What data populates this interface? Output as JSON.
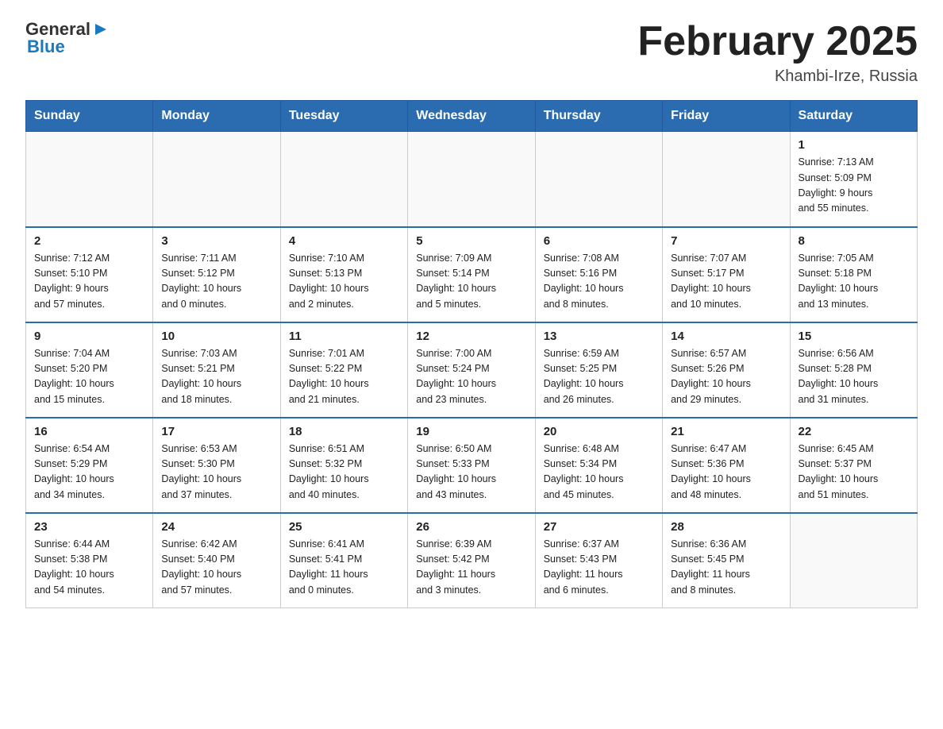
{
  "header": {
    "logo_general": "General",
    "logo_blue": "Blue",
    "month_title": "February 2025",
    "location": "Khambi-Irze, Russia"
  },
  "days_of_week": [
    "Sunday",
    "Monday",
    "Tuesday",
    "Wednesday",
    "Thursday",
    "Friday",
    "Saturday"
  ],
  "weeks": [
    [
      {
        "day": "",
        "info": ""
      },
      {
        "day": "",
        "info": ""
      },
      {
        "day": "",
        "info": ""
      },
      {
        "day": "",
        "info": ""
      },
      {
        "day": "",
        "info": ""
      },
      {
        "day": "",
        "info": ""
      },
      {
        "day": "1",
        "info": "Sunrise: 7:13 AM\nSunset: 5:09 PM\nDaylight: 9 hours\nand 55 minutes."
      }
    ],
    [
      {
        "day": "2",
        "info": "Sunrise: 7:12 AM\nSunset: 5:10 PM\nDaylight: 9 hours\nand 57 minutes."
      },
      {
        "day": "3",
        "info": "Sunrise: 7:11 AM\nSunset: 5:12 PM\nDaylight: 10 hours\nand 0 minutes."
      },
      {
        "day": "4",
        "info": "Sunrise: 7:10 AM\nSunset: 5:13 PM\nDaylight: 10 hours\nand 2 minutes."
      },
      {
        "day": "5",
        "info": "Sunrise: 7:09 AM\nSunset: 5:14 PM\nDaylight: 10 hours\nand 5 minutes."
      },
      {
        "day": "6",
        "info": "Sunrise: 7:08 AM\nSunset: 5:16 PM\nDaylight: 10 hours\nand 8 minutes."
      },
      {
        "day": "7",
        "info": "Sunrise: 7:07 AM\nSunset: 5:17 PM\nDaylight: 10 hours\nand 10 minutes."
      },
      {
        "day": "8",
        "info": "Sunrise: 7:05 AM\nSunset: 5:18 PM\nDaylight: 10 hours\nand 13 minutes."
      }
    ],
    [
      {
        "day": "9",
        "info": "Sunrise: 7:04 AM\nSunset: 5:20 PM\nDaylight: 10 hours\nand 15 minutes."
      },
      {
        "day": "10",
        "info": "Sunrise: 7:03 AM\nSunset: 5:21 PM\nDaylight: 10 hours\nand 18 minutes."
      },
      {
        "day": "11",
        "info": "Sunrise: 7:01 AM\nSunset: 5:22 PM\nDaylight: 10 hours\nand 21 minutes."
      },
      {
        "day": "12",
        "info": "Sunrise: 7:00 AM\nSunset: 5:24 PM\nDaylight: 10 hours\nand 23 minutes."
      },
      {
        "day": "13",
        "info": "Sunrise: 6:59 AM\nSunset: 5:25 PM\nDaylight: 10 hours\nand 26 minutes."
      },
      {
        "day": "14",
        "info": "Sunrise: 6:57 AM\nSunset: 5:26 PM\nDaylight: 10 hours\nand 29 minutes."
      },
      {
        "day": "15",
        "info": "Sunrise: 6:56 AM\nSunset: 5:28 PM\nDaylight: 10 hours\nand 31 minutes."
      }
    ],
    [
      {
        "day": "16",
        "info": "Sunrise: 6:54 AM\nSunset: 5:29 PM\nDaylight: 10 hours\nand 34 minutes."
      },
      {
        "day": "17",
        "info": "Sunrise: 6:53 AM\nSunset: 5:30 PM\nDaylight: 10 hours\nand 37 minutes."
      },
      {
        "day": "18",
        "info": "Sunrise: 6:51 AM\nSunset: 5:32 PM\nDaylight: 10 hours\nand 40 minutes."
      },
      {
        "day": "19",
        "info": "Sunrise: 6:50 AM\nSunset: 5:33 PM\nDaylight: 10 hours\nand 43 minutes."
      },
      {
        "day": "20",
        "info": "Sunrise: 6:48 AM\nSunset: 5:34 PM\nDaylight: 10 hours\nand 45 minutes."
      },
      {
        "day": "21",
        "info": "Sunrise: 6:47 AM\nSunset: 5:36 PM\nDaylight: 10 hours\nand 48 minutes."
      },
      {
        "day": "22",
        "info": "Sunrise: 6:45 AM\nSunset: 5:37 PM\nDaylight: 10 hours\nand 51 minutes."
      }
    ],
    [
      {
        "day": "23",
        "info": "Sunrise: 6:44 AM\nSunset: 5:38 PM\nDaylight: 10 hours\nand 54 minutes."
      },
      {
        "day": "24",
        "info": "Sunrise: 6:42 AM\nSunset: 5:40 PM\nDaylight: 10 hours\nand 57 minutes."
      },
      {
        "day": "25",
        "info": "Sunrise: 6:41 AM\nSunset: 5:41 PM\nDaylight: 11 hours\nand 0 minutes."
      },
      {
        "day": "26",
        "info": "Sunrise: 6:39 AM\nSunset: 5:42 PM\nDaylight: 11 hours\nand 3 minutes."
      },
      {
        "day": "27",
        "info": "Sunrise: 6:37 AM\nSunset: 5:43 PM\nDaylight: 11 hours\nand 6 minutes."
      },
      {
        "day": "28",
        "info": "Sunrise: 6:36 AM\nSunset: 5:45 PM\nDaylight: 11 hours\nand 8 minutes."
      },
      {
        "day": "",
        "info": ""
      }
    ]
  ]
}
